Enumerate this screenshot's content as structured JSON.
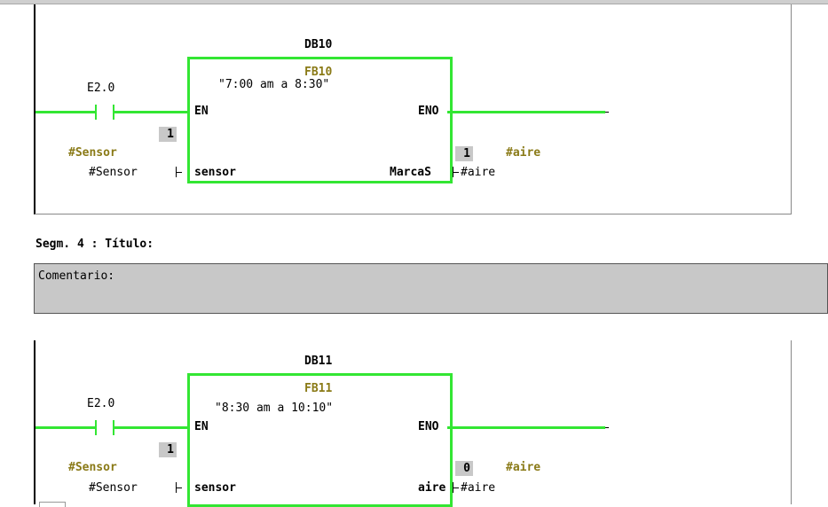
{
  "colors": {
    "wire": "#33e633",
    "olive": "#8a7a17",
    "grey": "#c8c8c8"
  },
  "network3": {
    "db": "DB10",
    "fb": "FB10",
    "fb_comment": "\"7:00 am a 8:30\"",
    "contact_addr": "E2.0",
    "contact_symbol": "#Sensor",
    "en": "EN",
    "eno": "ENO",
    "in_pin": "sensor",
    "in_value": "#Sensor",
    "in_status": "1",
    "out_pin": "MarcaS",
    "out_value": "#aire",
    "out_status": "1",
    "out_symbol": "#aire"
  },
  "segment4": {
    "title": "Segm.  4 : Título:",
    "comment": "Comentario:"
  },
  "network5": {
    "db": "DB11",
    "fb": "FB11",
    "fb_comment": "\"8:30 am a 10:10\"",
    "contact_addr": "E2.0",
    "contact_symbol": "#Sensor",
    "en": "EN",
    "eno": "ENO",
    "in_pin": "sensor",
    "in_value": "#Sensor",
    "in_status": "1",
    "out_pin": "aire",
    "out_value": "#aire",
    "out_status": "0",
    "out_symbol": "#aire"
  }
}
